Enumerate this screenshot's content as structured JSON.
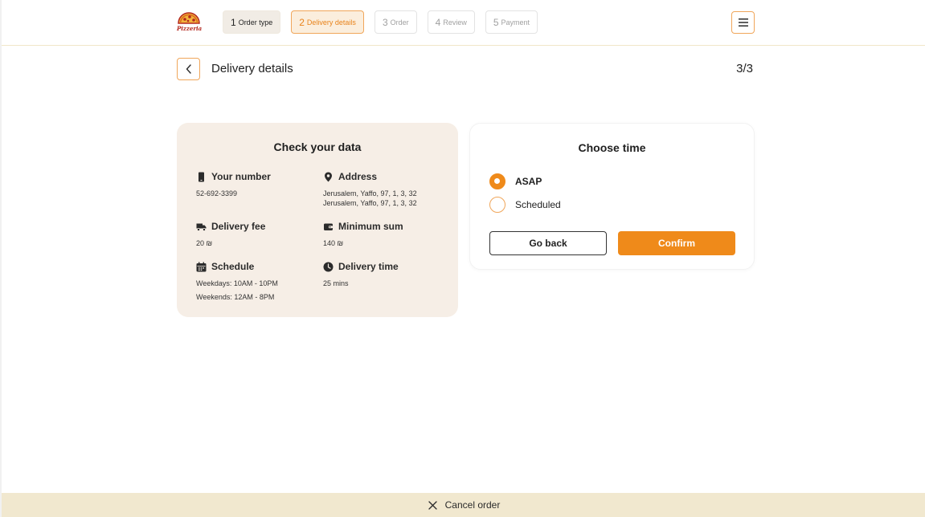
{
  "brand": {
    "logo_text": "Pizzeria",
    "logo_icon": "pizza-icon",
    "accent": "#ef8a1a",
    "accent_light": "#fbeedd"
  },
  "steps": [
    {
      "num": "1",
      "label": "Order type",
      "state": "done"
    },
    {
      "num": "2",
      "label": "Delivery details",
      "state": "active"
    },
    {
      "num": "3",
      "label": "Order",
      "state": "upcoming"
    },
    {
      "num": "4",
      "label": "Review",
      "state": "upcoming"
    },
    {
      "num": "5",
      "label": "Payment",
      "state": "upcoming"
    }
  ],
  "header": {
    "menu_icon": "hamburger-menu-icon"
  },
  "page": {
    "title": "Delivery details",
    "counter": "3/3",
    "back_icon": "chevron-left-icon"
  },
  "data_card": {
    "title": "Check your data",
    "number": {
      "label": "Your number",
      "value": "52-692-3399",
      "icon": "phone-icon"
    },
    "address": {
      "label": "Address",
      "line1": "Jerusalem, Yaffo, 97, 1, 3, 32",
      "line2": "Jerusalem, Yaffo, 97, 1, 3, 32",
      "icon": "location-pin-icon"
    },
    "fee": {
      "label": "Delivery fee",
      "value": "20 ₪",
      "icon": "delivery-truck-icon"
    },
    "minimum": {
      "label": "Minimum sum",
      "value": "140 ₪",
      "icon": "wallet-icon"
    },
    "schedule": {
      "label": "Schedule",
      "weekdays": "Weekdays: 10AM - 10PM",
      "weekends": "Weekends: 12AM - 8PM",
      "icon": "calendar-icon"
    },
    "delivery_time": {
      "label": "Delivery time",
      "value": "25 mins",
      "icon": "clock-icon"
    }
  },
  "time_card": {
    "title": "Choose time",
    "options": [
      {
        "label": "ASAP",
        "selected": true
      },
      {
        "label": "Scheduled",
        "selected": false
      }
    ],
    "back_label": "Go back",
    "confirm_label": "Confirm"
  },
  "footer": {
    "cancel_label": "Cancel order",
    "cancel_icon": "close-icon",
    "bar_color": "#f1e8cf"
  }
}
